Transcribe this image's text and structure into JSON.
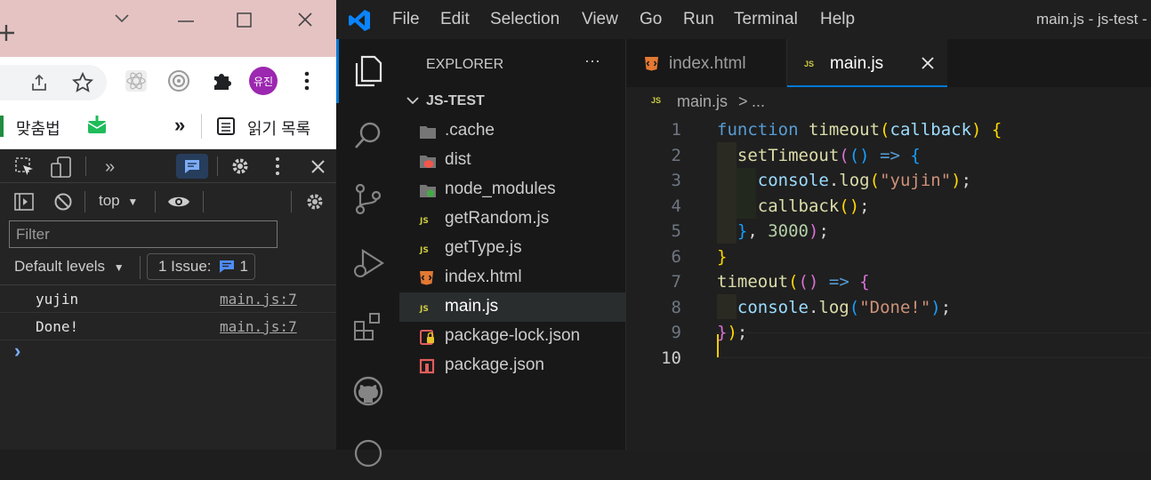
{
  "chrome": {
    "bookmarks": [
      "맞춤법",
      "»",
      "읽기 목록"
    ],
    "profile_initials": "유진"
  },
  "devtools": {
    "context": "top",
    "filter_placeholder": "Filter",
    "levels": "Default levels",
    "issues": "1 Issue:",
    "issues_count": "1",
    "console": [
      {
        "text": "yujin",
        "source": "main.js:7"
      },
      {
        "text": "Done!",
        "source": "main.js:7"
      }
    ],
    "prompt": "›"
  },
  "vscode": {
    "menu": [
      "File",
      "Edit",
      "Selection",
      "View",
      "Go",
      "Run",
      "Terminal",
      "Help"
    ],
    "title": "main.js - js-test -",
    "explorer_title": "EXPLORER",
    "more": "···",
    "project": "JS-TEST",
    "files": [
      {
        "name": ".cache",
        "icon": "folder-icon"
      },
      {
        "name": "dist",
        "icon": "folder-dist-icon"
      },
      {
        "name": "node_modules",
        "icon": "folder-node-icon"
      },
      {
        "name": "getRandom.js",
        "icon": "js-file-icon"
      },
      {
        "name": "getType.js",
        "icon": "js-file-icon"
      },
      {
        "name": "index.html",
        "icon": "html-file-icon"
      },
      {
        "name": "main.js",
        "icon": "js-file-icon"
      },
      {
        "name": "package-lock.json",
        "icon": "lock-json-icon"
      },
      {
        "name": "package.json",
        "icon": "npm-json-icon"
      }
    ],
    "tabs": [
      {
        "label": "index.html"
      },
      {
        "label": "main.js"
      }
    ],
    "breadcrumb": {
      "file": "main.js",
      "sep": ">",
      "rest": "..."
    },
    "code_lines": [
      "1",
      "2",
      "3",
      "4",
      "5",
      "6",
      "7",
      "8",
      "9",
      "10"
    ],
    "js_badge": "JS",
    "colors": {
      "accent": "#0078d4",
      "active_tab_border": "#0078d4",
      "js_yellow": "#cbcb41",
      "html_orange": "#e37933"
    }
  }
}
